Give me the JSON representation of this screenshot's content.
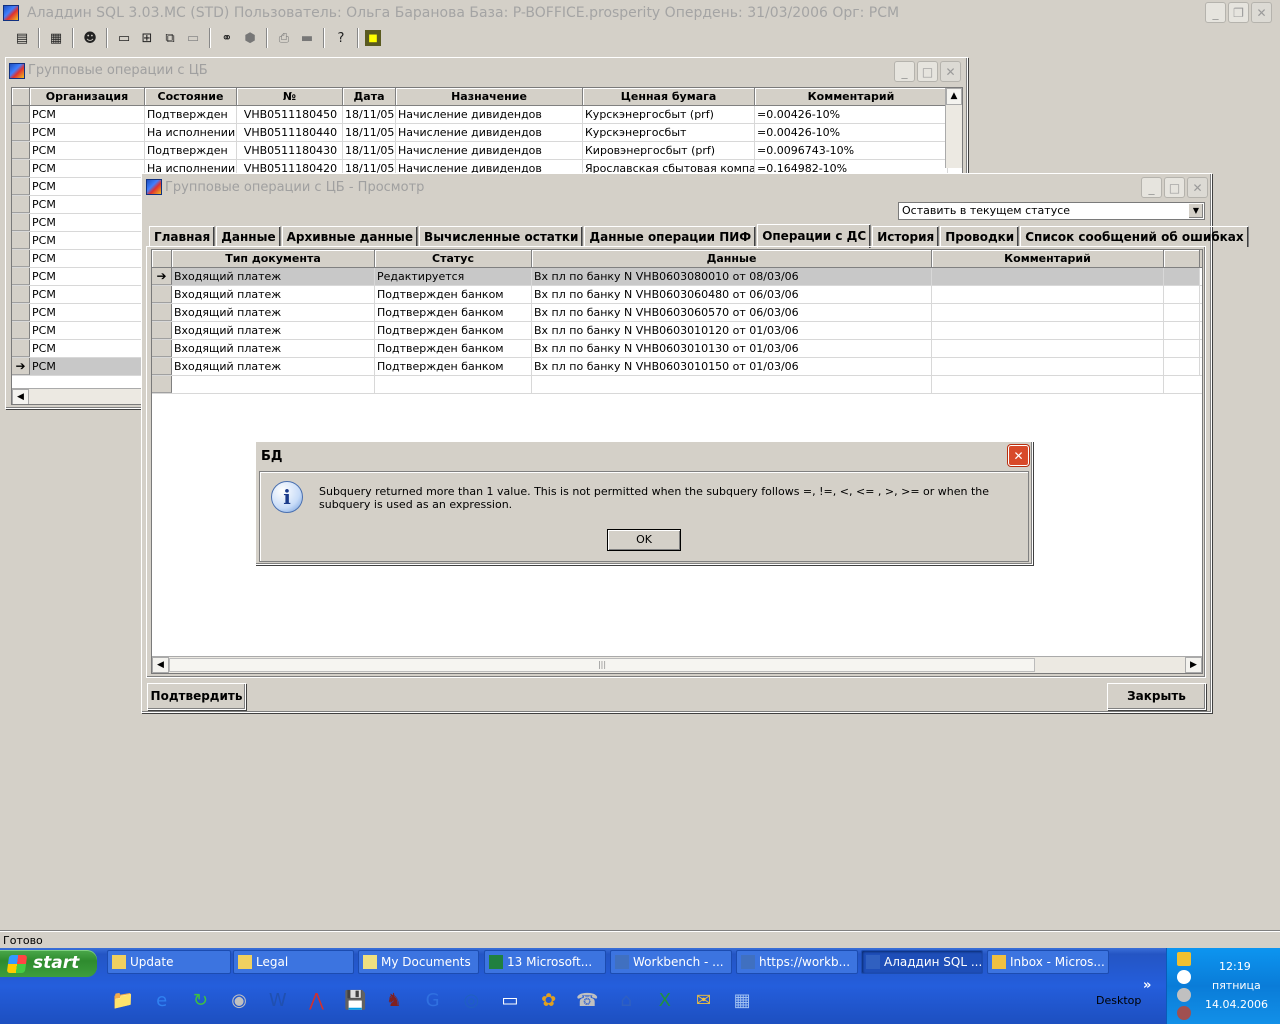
{
  "app": {
    "title": "Аладдин SQL 3.03.МС (STD)  Пользователь: Ольга Баранова База: P-BOFFICE.prosperity Опердень: 31/03/2006 Орг: РСМ",
    "status": "Готово"
  },
  "toolbar_icons": [
    "document-icon",
    "database-icon",
    "user-search-icon",
    "window-icon",
    "tile-icon",
    "cascade-icon",
    "minimize-all-icon",
    "binoculars-icon",
    "stamp-icon",
    "printer-icon",
    "folder-icon",
    "help-icon",
    "exit-icon"
  ],
  "bg_window": {
    "title": "Групповые операции с ЦБ",
    "columns": [
      "Организация",
      "Состояние",
      "№",
      "Дата",
      "Назначение",
      "Ценная бумага",
      "Комментарий"
    ],
    "rows": [
      [
        "РСМ",
        "Подтвержден",
        "VHB0511180450",
        "18/11/05",
        "Начисление дивидендов",
        "Курскэнергосбыт (prf)",
        "=0.00426-10%"
      ],
      [
        "РСМ",
        "На исполнении",
        "VHB0511180440",
        "18/11/05",
        "Начисление дивидендов",
        "Курскэнергосбыт",
        "=0.00426-10%"
      ],
      [
        "РСМ",
        "Подтвержден",
        "VHB0511180430",
        "18/11/05",
        "Начисление дивидендов",
        "Кировэнергосбыт (prf)",
        "=0.0096743-10%"
      ],
      [
        "РСМ",
        "На исполнении",
        "VHB0511180420",
        "18/11/05",
        "Начисление дивидендов",
        "Ярославская сбытовая компания",
        "=0.164982-10%"
      ],
      [
        "РСМ",
        "",
        "",
        "",
        "",
        "",
        ""
      ],
      [
        "РСМ",
        "",
        "",
        "",
        "",
        "",
        ""
      ],
      [
        "РСМ",
        "",
        "",
        "",
        "",
        "",
        ""
      ],
      [
        "РСМ",
        "",
        "",
        "",
        "",
        "",
        ""
      ],
      [
        "РСМ",
        "",
        "",
        "",
        "",
        "",
        ""
      ],
      [
        "РСМ",
        "",
        "",
        "",
        "",
        "",
        ""
      ],
      [
        "РСМ",
        "",
        "",
        "",
        "",
        "",
        ""
      ],
      [
        "РСМ",
        "",
        "",
        "",
        "",
        "",
        ""
      ],
      [
        "РСМ",
        "",
        "",
        "",
        "",
        "",
        ""
      ],
      [
        "РСМ",
        "",
        "",
        "",
        "",
        "",
        ""
      ],
      [
        "РСМ",
        "",
        "",
        "",
        "",
        "",
        ""
      ]
    ]
  },
  "fg_window": {
    "title": "Групповые операции с ЦБ - Просмотр",
    "status_select": "Оставить в текущем статусе",
    "tabs": [
      "Главная",
      "Данные",
      "Архивные данные",
      "Вычисленные остатки",
      "Данные операции ПИФ",
      "Операции с ДС",
      "История",
      "Проводки",
      "Список сообщений об ошибках"
    ],
    "active_tab": "Операции с ДС",
    "columns": [
      "Тип документа",
      "Статус",
      "Данные",
      "Комментарий"
    ],
    "rows": [
      [
        "Входящий платеж",
        "Редактируется",
        "Вх пл по банку N VHB0603080010 от 08/03/06",
        ""
      ],
      [
        "Входящий платеж",
        "Подтвержден банком",
        "Вх пл по банку N VHB0603060480 от 06/03/06",
        ""
      ],
      [
        "Входящий платеж",
        "Подтвержден банком",
        "Вх пл по банку N VHB0603060570 от 06/03/06",
        ""
      ],
      [
        "Входящий платеж",
        "Подтвержден банком",
        "Вх пл по банку N VHB0603010120 от 01/03/06",
        ""
      ],
      [
        "Входящий платеж",
        "Подтвержден банком",
        "Вх пл по банку N VHB0603010130 от 01/03/06",
        ""
      ],
      [
        "Входящий платеж",
        "Подтвержден банком",
        "Вх пл по банку N VHB0603010150 от 01/03/06",
        ""
      ]
    ],
    "confirm_label": "Подтвердить",
    "close_label": "Закрыть"
  },
  "dialog": {
    "title": "БД",
    "message": "Subquery returned more than 1 value. This is not permitted when the subquery follows =, !=, <, <= , >, >= or when the subquery is used as an expression.",
    "ok_label": "OK"
  },
  "taskbar": {
    "start_label": "start",
    "tasks": [
      "Update",
      "Legal",
      "My Documents",
      "13 Microsoft...",
      "Workbench - ...",
      "https://workb...",
      "Аладдин SQL ...",
      "Inbox - Micros..."
    ],
    "quicklaunch": [
      "folder-icon",
      "ie-icon",
      "refresh-icon",
      "drive-icon",
      "word-icon",
      "acrobat-icon",
      "floppy-icon",
      "chess-icon",
      "app-icon",
      "ring-icon",
      "window-icon",
      "globe-icon",
      "phone-icon",
      "network-icon",
      "excel-icon",
      "outlook-icon",
      "calculator-icon"
    ],
    "desktop_label": "Desktop",
    "chevron": "»",
    "clock_time": "12:19",
    "clock_day": "пятница",
    "clock_date": "14.04.2006"
  }
}
